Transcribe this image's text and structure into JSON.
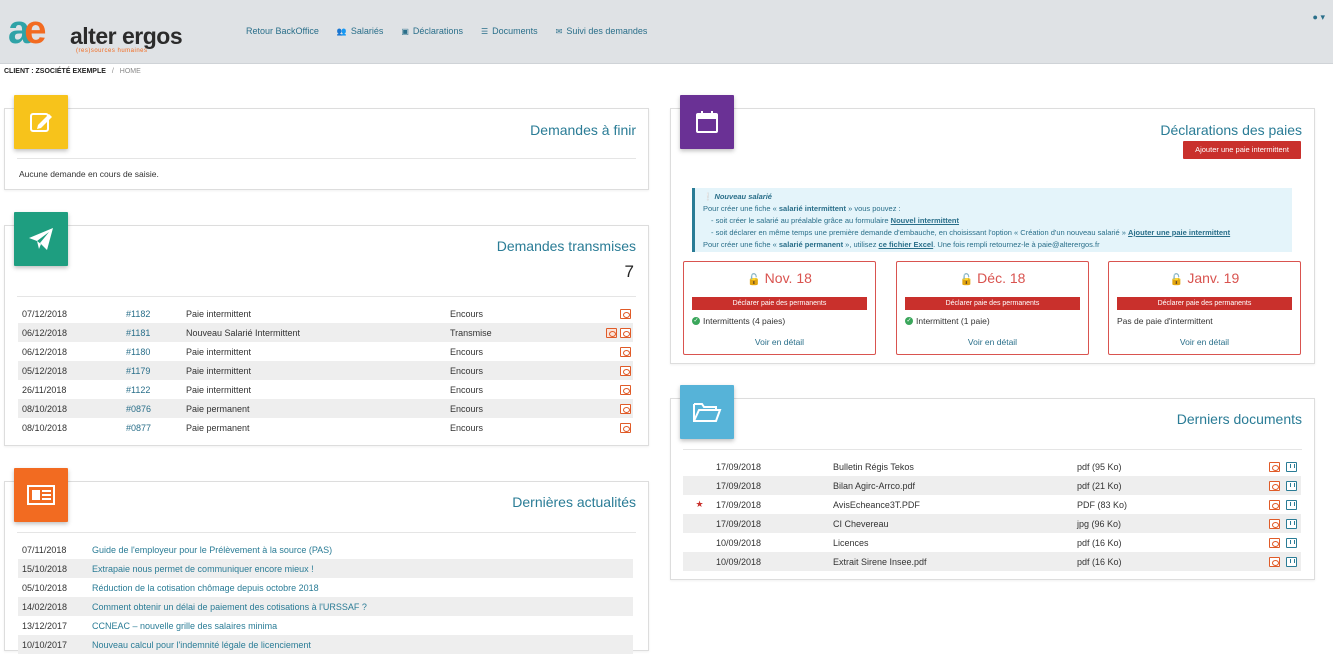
{
  "header": {
    "logo_text": "alter ergos",
    "logo_sub": "(res)sources humaines",
    "nav": [
      {
        "label": "Retour BackOffice",
        "icon": "none"
      },
      {
        "label": "Salariés",
        "icon": "users-icon"
      },
      {
        "label": "Déclarations",
        "icon": "calendar-icon"
      },
      {
        "label": "Documents",
        "icon": "database-icon"
      },
      {
        "label": "Suivi des demandes",
        "icon": "envelope-icon"
      }
    ],
    "user_icon": "user-icon"
  },
  "breadcrumb": {
    "client": "CLIENT : ZSOCIÉTÉ EXEMPLE",
    "sep": "/",
    "home": "HOME"
  },
  "demandes_a_finir": {
    "title": "Demandes à finir",
    "empty_text": "Aucune demande en cours de saisie."
  },
  "demandes_transmises": {
    "title": "Demandes transmises",
    "count": "7",
    "rows": [
      {
        "date": "07/12/2018",
        "ref": "#1182",
        "type": "Paie intermittent",
        "status": "Encours"
      },
      {
        "date": "06/12/2018",
        "ref": "#1181",
        "type": "Nouveau Salarié Intermittent",
        "status": "Transmise"
      },
      {
        "date": "06/12/2018",
        "ref": "#1180",
        "type": "Paie intermittent",
        "status": "Encours"
      },
      {
        "date": "05/12/2018",
        "ref": "#1179",
        "type": "Paie intermittent",
        "status": "Encours"
      },
      {
        "date": "26/11/2018",
        "ref": "#1122",
        "type": "Paie intermittent",
        "status": "Encours"
      },
      {
        "date": "08/10/2018",
        "ref": "#0876",
        "type": "Paie permanent",
        "status": "Encours"
      },
      {
        "date": "08/10/2018",
        "ref": "#0877",
        "type": "Paie permanent",
        "status": "Encours"
      }
    ]
  },
  "actualites": {
    "title": "Dernières actualités",
    "rows": [
      {
        "date": "07/11/2018",
        "title": "Guide de l'employeur pour le Prélèvement à la source (PAS)"
      },
      {
        "date": "15/10/2018",
        "title": "Extrapaie nous permet de communiquer encore mieux !"
      },
      {
        "date": "05/10/2018",
        "title": "Réduction de la cotisation chômage depuis octobre 2018"
      },
      {
        "date": "14/02/2018",
        "title": "Comment obtenir un délai de paiement des cotisations à l'URSSAF ?"
      },
      {
        "date": "13/12/2017",
        "title": "CCNEAC – nouvelle grille des salaires minima"
      },
      {
        "date": "10/10/2017",
        "title": "Nouveau calcul pour l'indemnité légale de licenciement"
      }
    ]
  },
  "declarations": {
    "title": "Déclarations des paies",
    "add_button": "Ajouter une paie intermittent",
    "info": {
      "heading": "Nouveau salarié",
      "line1_pre": "Pour créer une fiche « ",
      "line1_bold": "salarié intermittent",
      "line1_post": " » vous pouvez :",
      "line2_pre": "- soit créer le salarié au préalable grâce au formulaire ",
      "line2_link": "Nouvel intermittent",
      "line3_pre": "- soit déclarer en même temps une première demande d'embauche, en choisissant l'option « Création d'un nouveau salarié » ",
      "line3_link": "Ajouter une paie intermittent",
      "line4_pre": "Pour créer une fiche « ",
      "line4_bold": "salarié permanent",
      "line4_mid": " », utilisez ",
      "line4_link": "ce fichier Excel",
      "line4_post": ". Une fois rempli retournez-le à paie@alterergos.fr"
    },
    "months": [
      {
        "label": "Nov. 18",
        "button": "Déclarer paie des permanents",
        "status": "Intermittents (4 paies)",
        "ok": true,
        "link": "Voir en détail"
      },
      {
        "label": "Déc. 18",
        "button": "Déclarer paie des permanents",
        "status": "Intermittent (1 paie)",
        "ok": true,
        "link": "Voir en détail"
      },
      {
        "label": "Janv. 19",
        "button": "Déclarer paie des permanents",
        "status": "Pas de paie d'intermittent",
        "ok": false,
        "link": "Voir en détail"
      }
    ]
  },
  "documents": {
    "title": "Derniers documents",
    "rows": [
      {
        "star": "",
        "date": "17/09/2018",
        "name": "Bulletin Régis Tekos",
        "size": "pdf (95 Ko)"
      },
      {
        "star": "",
        "date": "17/09/2018",
        "name": "Bilan Agirc-Arrco.pdf",
        "size": "pdf (21 Ko)"
      },
      {
        "star": "★",
        "date": "17/09/2018",
        "name": "AvisEcheance3T.PDF",
        "size": "PDF (83 Ko)"
      },
      {
        "star": "",
        "date": "17/09/2018",
        "name": "CI Chevereau",
        "size": "jpg (96 Ko)"
      },
      {
        "star": "",
        "date": "10/09/2018",
        "name": "Licences",
        "size": "pdf (16 Ko)"
      },
      {
        "star": "",
        "date": "10/09/2018",
        "name": "Extrait Sirene Insee.pdf",
        "size": "pdf (16 Ko)"
      }
    ]
  },
  "colors": {
    "teal": "#2a7c96",
    "yellow_tile": "#f7c31b",
    "green_tile": "#1e9e80",
    "orange_tile": "#f26b21",
    "purple_tile": "#6a3195",
    "blue_tile": "#56b3d8",
    "red": "#c9302c"
  }
}
